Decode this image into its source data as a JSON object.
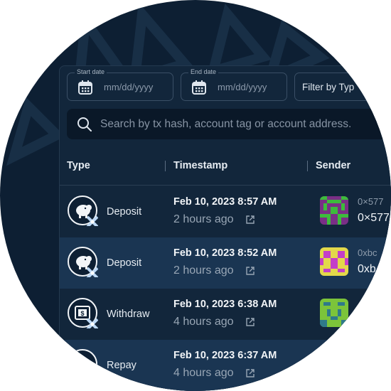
{
  "filters": {
    "start_date": {
      "label": "Start date",
      "placeholder": "mm/dd/yyyy"
    },
    "end_date": {
      "label": "End date",
      "placeholder": "mm/dd/yyyy"
    },
    "type_filter": {
      "label": "Filter by Typ"
    }
  },
  "search": {
    "placeholder": "Search by tx hash, account tag or account address."
  },
  "table": {
    "columns": [
      "Type",
      "Timestamp",
      "Sender"
    ],
    "rows": [
      {
        "type": "Deposit",
        "type_icon": "deposit-pig-icon",
        "timestamp": "Feb 10, 2023 8:57 AM",
        "relative": "2 hours ago",
        "sender_short": "0×577",
        "sender_addr": "0×577"
      },
      {
        "type": "Deposit",
        "type_icon": "deposit-pig-icon",
        "timestamp": "Feb 10, 2023 8:52 AM",
        "relative": "2 hours ago",
        "sender_short": "0xbc",
        "sender_addr": "0xb"
      },
      {
        "type": "Withdraw",
        "type_icon": "withdraw-cash-icon",
        "timestamp": "Feb 10, 2023 6:38 AM",
        "relative": "4 hours ago",
        "sender_short": "",
        "sender_addr": ""
      },
      {
        "type": "Repay",
        "type_icon": "repay-icon",
        "timestamp": "Feb 10, 2023 6:37 AM",
        "relative": "4 hours ago",
        "sender_short": "",
        "sender_addr": ""
      }
    ]
  },
  "colors": {
    "background": "#0d1f33",
    "panel": "#12263b",
    "row_alt": "#1a3552",
    "accent_badge": "#bcd8f5"
  }
}
